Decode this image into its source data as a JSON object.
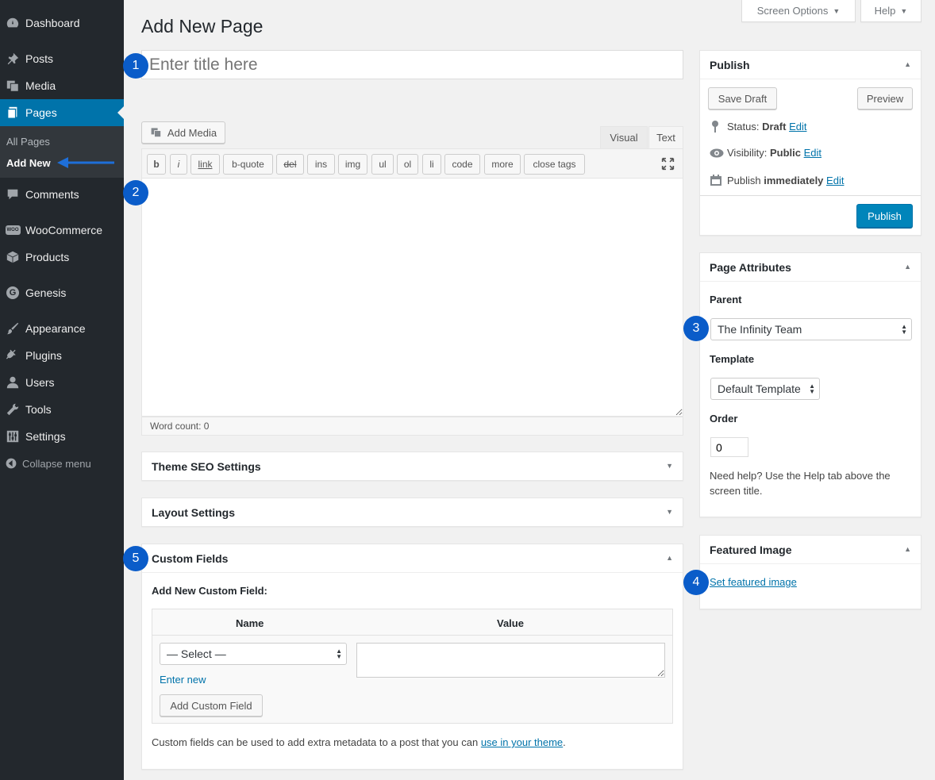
{
  "sidebar": {
    "items": [
      {
        "label": "Dashboard",
        "icon": "dashboard-icon"
      },
      {
        "label": "Posts",
        "icon": "pin-icon"
      },
      {
        "label": "Media",
        "icon": "media-icon"
      },
      {
        "label": "Pages",
        "icon": "pages-icon"
      },
      {
        "label": "Comments",
        "icon": "comment-icon"
      },
      {
        "label": "WooCommerce",
        "icon": "woocommerce-icon"
      },
      {
        "label": "Products",
        "icon": "box-icon"
      },
      {
        "label": "Genesis",
        "icon": "genesis-icon"
      },
      {
        "label": "Appearance",
        "icon": "brush-icon"
      },
      {
        "label": "Plugins",
        "icon": "plug-icon"
      },
      {
        "label": "Users",
        "icon": "user-icon"
      },
      {
        "label": "Tools",
        "icon": "wrench-icon"
      },
      {
        "label": "Settings",
        "icon": "sliders-icon"
      }
    ],
    "submenu": {
      "all_pages": "All Pages",
      "add_new": "Add New"
    },
    "collapse": "Collapse menu",
    "woo_badge": "WOO",
    "genesis_letter": "G"
  },
  "top": {
    "screen_options": "Screen Options",
    "help": "Help"
  },
  "page_title": "Add New Page",
  "title_placeholder": "Enter title here",
  "editor": {
    "add_media": "Add Media",
    "tab_visual": "Visual",
    "tab_text": "Text",
    "quicktags": {
      "b": "b",
      "i": "i",
      "link": "link",
      "bquote": "b-quote",
      "del": "del",
      "ins": "ins",
      "img": "img",
      "ul": "ul",
      "ol": "ol",
      "li": "li",
      "code": "code",
      "more": "more",
      "close": "close tags"
    },
    "word_count": "Word count: 0"
  },
  "boxes": {
    "seo": "Theme SEO Settings",
    "layout": "Layout Settings",
    "custom_fields": {
      "title": "Custom Fields",
      "add_new": "Add New Custom Field:",
      "col_name": "Name",
      "col_value": "Value",
      "select": "— Select —",
      "enter_new": "Enter new",
      "add_button": "Add Custom Field",
      "help_text": "Custom fields can be used to add extra metadata to a post that you can",
      "help_link": "use in your theme",
      "help_end": "."
    }
  },
  "publish": {
    "title": "Publish",
    "save_draft": "Save Draft",
    "preview": "Preview",
    "status_label": "Status:",
    "status_value": "Draft",
    "visibility_label": "Visibility:",
    "visibility_value": "Public",
    "publish_label": "Publish",
    "publish_value": "immediately",
    "edit": "Edit",
    "publish_button": "Publish"
  },
  "page_attributes": {
    "title": "Page Attributes",
    "parent_label": "Parent",
    "parent_value": "The Infinity Team",
    "template_label": "Template",
    "template_value": "Default Template",
    "order_label": "Order",
    "order_value": "0",
    "help": "Need help? Use the Help tab above the screen title."
  },
  "featured_image": {
    "title": "Featured Image",
    "link": "Set featured image"
  },
  "annotations": {
    "b1": "1",
    "b2": "2",
    "b3": "3",
    "b4": "4",
    "b5": "5"
  },
  "colors": {
    "accent": "#0073aa",
    "sidebar": "#23282d",
    "badge": "#0a5cc9",
    "primary_button": "#0085ba"
  }
}
